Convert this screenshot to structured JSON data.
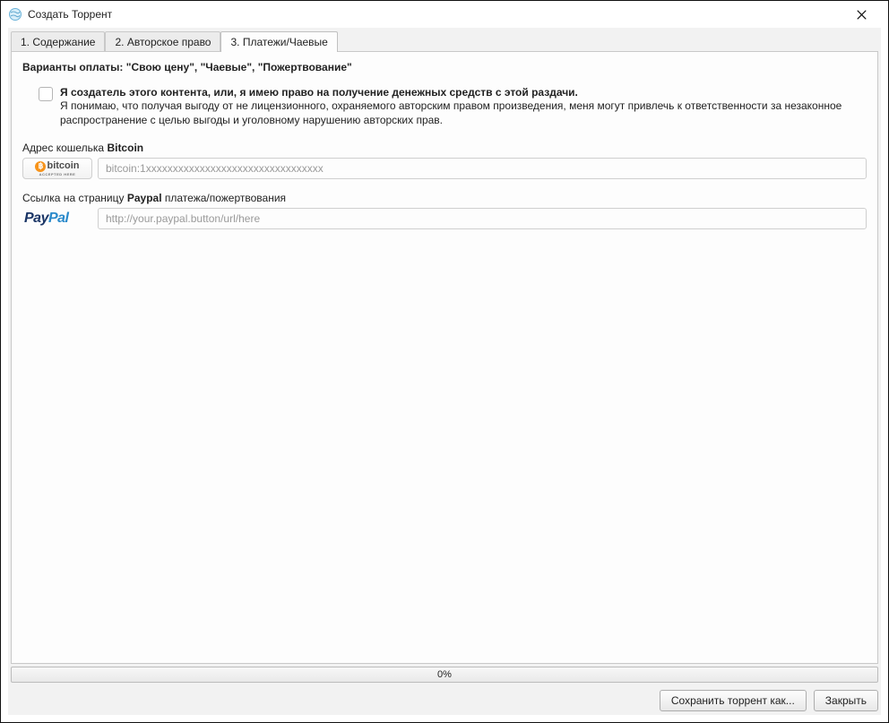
{
  "window": {
    "title": "Создать Торрент"
  },
  "tabs": {
    "t1": "1. Содержание",
    "t2": "2. Авторское право",
    "t3": "3. Платежи/Чаевые"
  },
  "section": {
    "title": "Варианты оплаты: \"Свою цену\", \"Чаевые\", \"Пожертвование\""
  },
  "creator": {
    "line1": "Я создатель этого контента, или, я имею право на получение денежных средств с этой раздачи.",
    "line2": "Я понимаю, что получая выгоду от не лицензионного, охраняемого авторским правом произведения, меня могут привлечь к ответственности за незаконное распространение с целью выгоды и уголовному нарушению авторских прав."
  },
  "bitcoin": {
    "label_prefix": "Адрес кошелька ",
    "label_bold": "Bitcoin",
    "logo_text": "bitcoin",
    "logo_sub": "ACCEPTED HERE",
    "placeholder": "bitcoin:1xxxxxxxxxxxxxxxxxxxxxxxxxxxxxxxxx"
  },
  "paypal": {
    "label_prefix": "Ссылка на страницу ",
    "label_bold": "Paypal",
    "label_suffix": " платежа/пожертвования",
    "logo_p1": "Pay",
    "logo_p2": "Pal",
    "placeholder": "http://your.paypal.button/url/here"
  },
  "progress": {
    "text": "0%"
  },
  "buttons": {
    "save_as": "Сохранить торрент как...",
    "close": "Закрыть"
  }
}
